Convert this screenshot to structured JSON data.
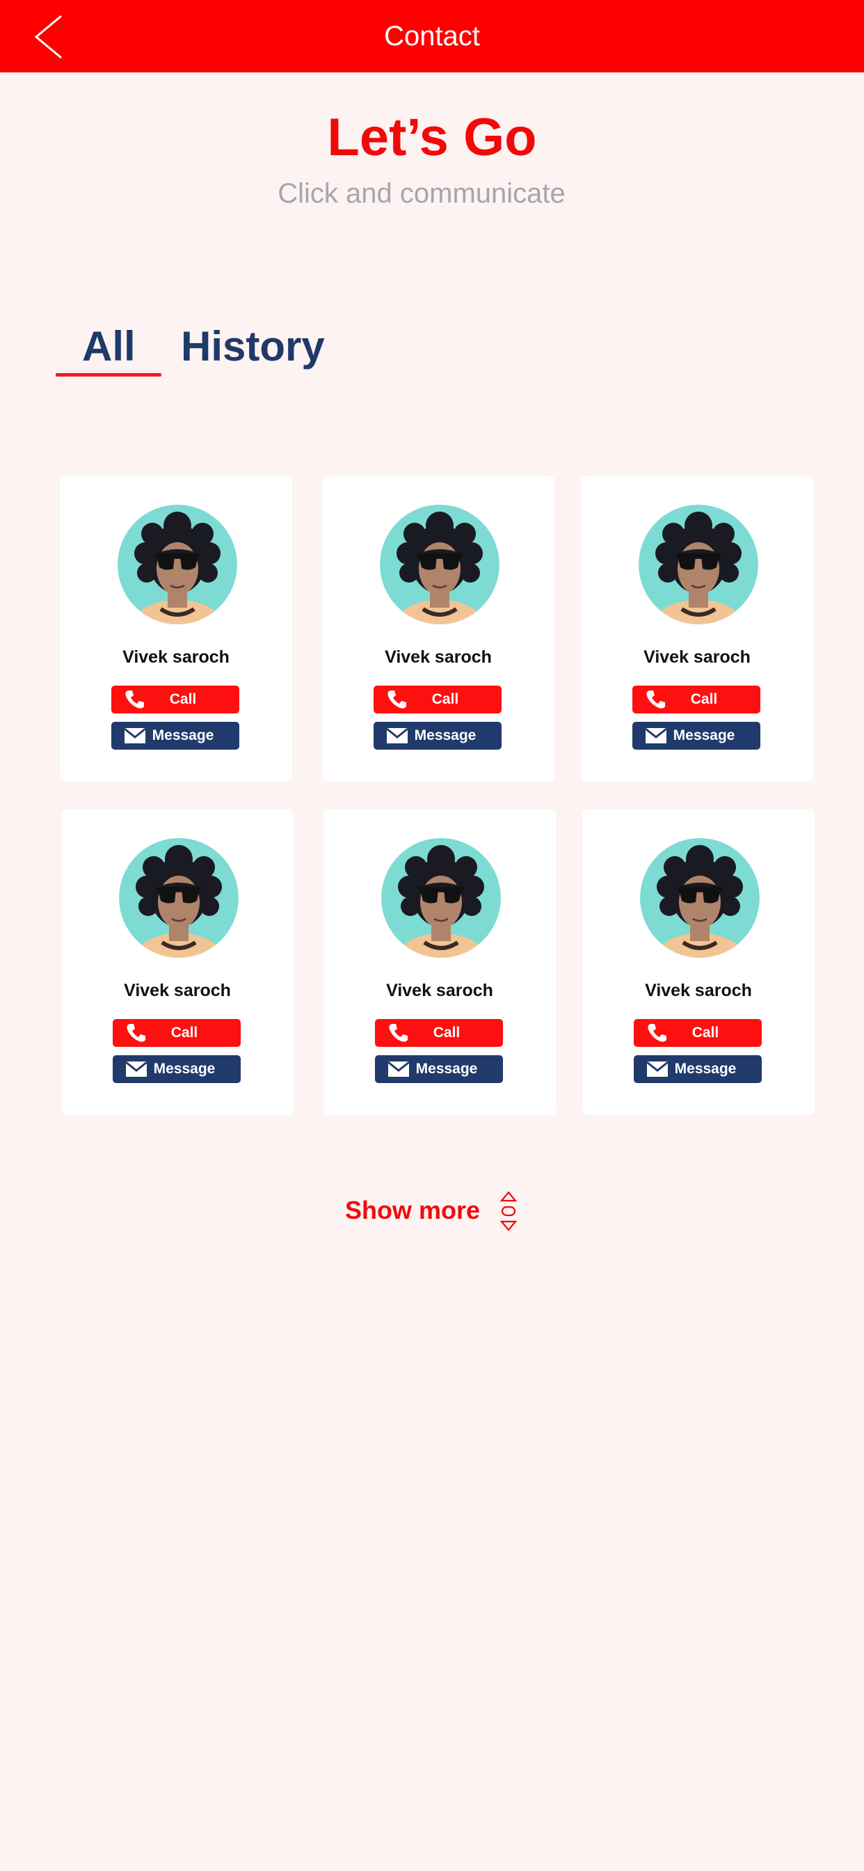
{
  "header": {
    "title": "Contact"
  },
  "hero": {
    "title": "Let’s Go",
    "subtitle": "Click and communicate"
  },
  "tabs": [
    {
      "label": "All",
      "active": true
    },
    {
      "label": "History",
      "active": false
    }
  ],
  "contacts": [
    {
      "name": "Vivek saroch",
      "call_label": "Call",
      "message_label": "Message"
    },
    {
      "name": "Vivek saroch",
      "call_label": "Call",
      "message_label": "Message"
    },
    {
      "name": "Vivek saroch",
      "call_label": "Call",
      "message_label": "Message"
    },
    {
      "name": "Vivek saroch",
      "call_label": "Call",
      "message_label": "Message"
    },
    {
      "name": "Vivek saroch",
      "call_label": "Call",
      "message_label": "Message"
    },
    {
      "name": "Vivek saroch",
      "call_label": "Call",
      "message_label": "Message"
    }
  ],
  "footer": {
    "show_more_label": "Show more"
  },
  "colors": {
    "primary_red": "#ff0000",
    "navy": "#213a6c",
    "background": "#fcf3f2",
    "avatar_bg": "#7ddbd4"
  },
  "icons": [
    "back-chevron-icon",
    "phone-icon",
    "envelope-icon",
    "scroll-updown-icon"
  ]
}
